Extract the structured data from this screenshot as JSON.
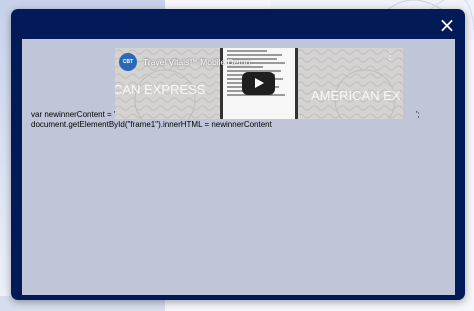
{
  "modal": {
    "close_glyph": "×"
  },
  "video": {
    "channel_logo_text": "CBT",
    "title": "Travel Vitals™ Mobile Demo",
    "menu_glyph": "⋮",
    "left_bg_text": "CAN EXPRESS",
    "right_bg_text": "AMERICAN EX"
  },
  "code": {
    "line1": "var newinnerContent = '",
    "line2": "document.getElementById(\"frame1\").innerHTML = newinnerContent",
    "line1_tail": "';"
  },
  "colors": {
    "modal_bg": "#021a58",
    "content_bg": "#c1c5d8"
  }
}
